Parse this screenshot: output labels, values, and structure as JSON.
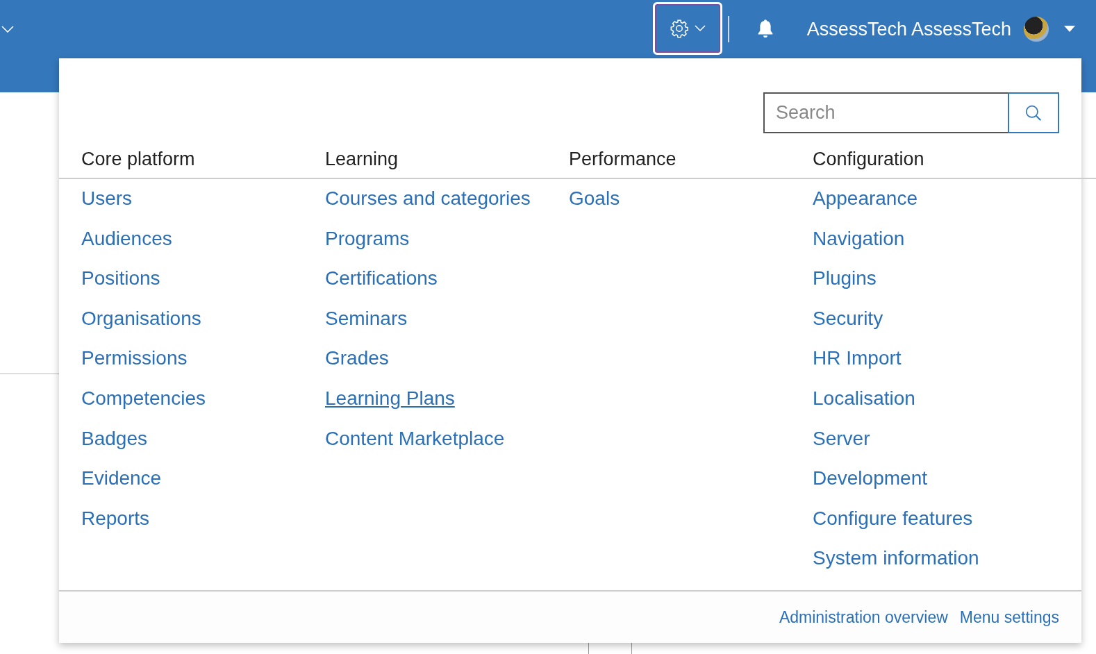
{
  "top_bar": {
    "user_name": "AssessTech AssessTech",
    "settings_menu_open": true
  },
  "admin_menu": {
    "search": {
      "placeholder": "Search"
    },
    "columns": [
      {
        "heading": "Core platform",
        "links": [
          {
            "label": "Users",
            "hovered": false
          },
          {
            "label": "Audiences",
            "hovered": false
          },
          {
            "label": "Positions",
            "hovered": false
          },
          {
            "label": "Organisations",
            "hovered": false
          },
          {
            "label": "Permissions",
            "hovered": false
          },
          {
            "label": "Competencies",
            "hovered": false
          },
          {
            "label": "Badges",
            "hovered": false
          },
          {
            "label": "Evidence",
            "hovered": false
          },
          {
            "label": "Reports",
            "hovered": false
          }
        ]
      },
      {
        "heading": "Learning",
        "links": [
          {
            "label": "Courses and categories",
            "hovered": false
          },
          {
            "label": "Programs",
            "hovered": false
          },
          {
            "label": "Certifications",
            "hovered": false
          },
          {
            "label": "Seminars",
            "hovered": false
          },
          {
            "label": "Grades",
            "hovered": false
          },
          {
            "label": "Learning Plans",
            "hovered": true
          },
          {
            "label": "Content Marketplace",
            "hovered": false
          }
        ]
      },
      {
        "heading": "Performance",
        "links": [
          {
            "label": "Goals",
            "hovered": false
          }
        ]
      },
      {
        "heading": "Configuration",
        "links": [
          {
            "label": "Appearance",
            "hovered": false
          },
          {
            "label": "Navigation",
            "hovered": false
          },
          {
            "label": "Plugins",
            "hovered": false
          },
          {
            "label": "Security",
            "hovered": false
          },
          {
            "label": "HR Import",
            "hovered": false
          },
          {
            "label": "Localisation",
            "hovered": false
          },
          {
            "label": "Server",
            "hovered": false
          },
          {
            "label": "Development",
            "hovered": false
          },
          {
            "label": "Configure features",
            "hovered": false
          },
          {
            "label": "System information",
            "hovered": false
          }
        ]
      }
    ],
    "footer_links": [
      "Administration overview",
      "Menu settings"
    ]
  }
}
